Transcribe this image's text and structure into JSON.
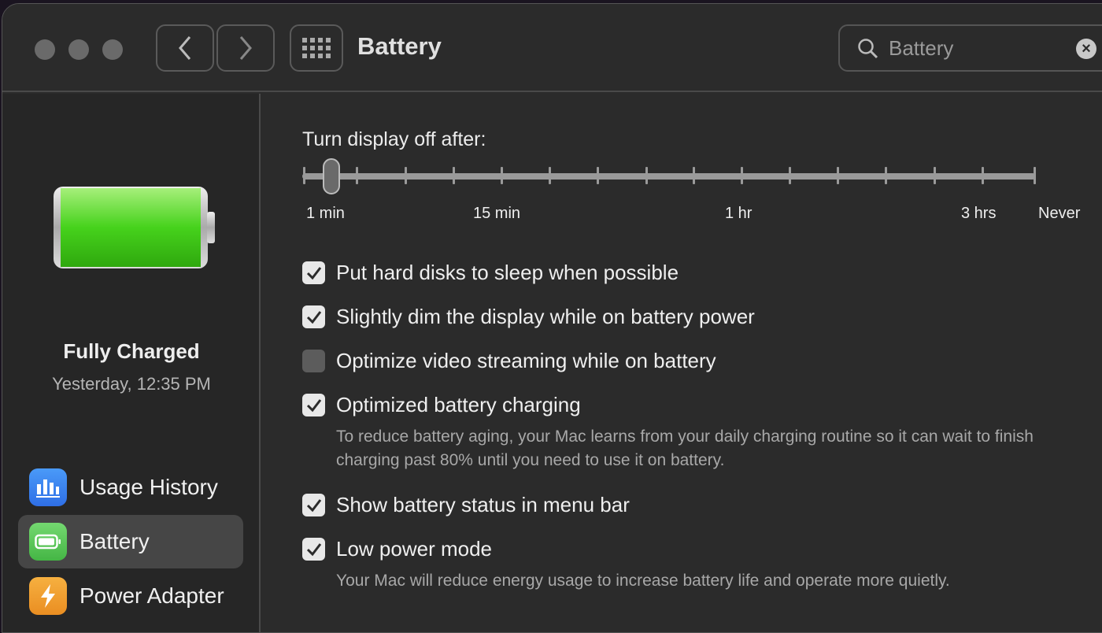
{
  "window": {
    "title": "Battery"
  },
  "search": {
    "value": "Battery",
    "icon": "search-icon"
  },
  "status": {
    "title": "Fully Charged",
    "time": "Yesterday, 12:35 PM",
    "level_percent": 100
  },
  "sidebar": {
    "items": [
      {
        "label": "Usage History",
        "icon": "chart-bars-icon",
        "color": "#3a82f0",
        "selected": false
      },
      {
        "label": "Battery",
        "icon": "battery-icon",
        "color": "#5cc75a",
        "selected": true
      },
      {
        "label": "Power Adapter",
        "icon": "lightning-icon",
        "color": "#f0a030",
        "selected": false
      }
    ]
  },
  "display_off": {
    "label": "Turn display off after:",
    "value": "1 min",
    "tick_labels": [
      "1 min",
      "15 min",
      "1 hr",
      "3 hrs",
      "Never"
    ]
  },
  "options": [
    {
      "label": "Put hard disks to sleep when possible",
      "checked": true
    },
    {
      "label": "Slightly dim the display while on battery power",
      "checked": true
    },
    {
      "label": "Optimize video streaming while on battery",
      "checked": false
    },
    {
      "label": "Optimized battery charging",
      "checked": true,
      "description": "To reduce battery aging, your Mac learns from your daily charging routine so it can wait to finish charging past 80% until you need to use it on battery."
    },
    {
      "label": "Show battery status in menu bar",
      "checked": true
    },
    {
      "label": "Low power mode",
      "checked": true,
      "description": "Your Mac will reduce energy usage to increase battery life and operate more quietly."
    }
  ]
}
